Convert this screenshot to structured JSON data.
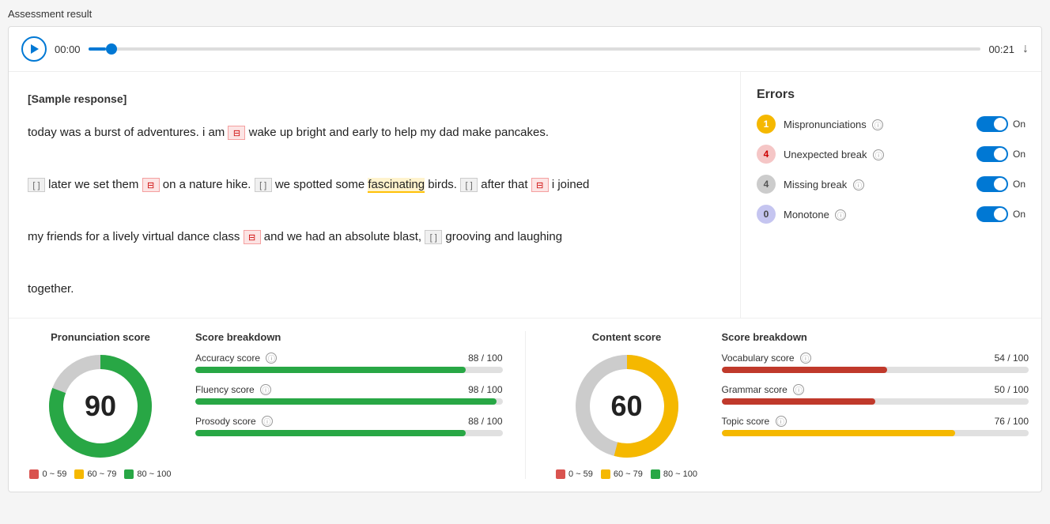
{
  "page": {
    "title": "Assessment result"
  },
  "audio": {
    "time_start": "00:00",
    "time_end": "00:21",
    "progress_pct": 2
  },
  "sample": {
    "label": "[Sample response]",
    "text_parts": [
      "today was a burst of adventures. i am",
      "wake up bright and early to help my dad make pancakes.",
      "later we set them",
      "on a nature hike.",
      "we spotted some",
      "fascinating",
      "birds.",
      "after that",
      "i joined my friends for a lively virtual dance class",
      "and we had an absolute blast,",
      "grooving and laughing together."
    ]
  },
  "errors": {
    "title": "Errors",
    "items": [
      {
        "badge": "1",
        "badge_color": "yellow",
        "label": "Mispronunciations",
        "toggle": "On"
      },
      {
        "badge": "4",
        "badge_color": "pink",
        "label": "Unexpected break",
        "toggle": "On"
      },
      {
        "badge": "4",
        "badge_color": "gray",
        "label": "Missing break",
        "toggle": "On"
      },
      {
        "badge": "0",
        "badge_color": "purple",
        "label": "Monotone",
        "toggle": "On"
      }
    ]
  },
  "pronunciation": {
    "title": "Pronunciation score",
    "score": "90",
    "breakdown_title": "Score breakdown",
    "items": [
      {
        "label": "Accuracy score",
        "value": "88 / 100",
        "pct": 88,
        "color": "green"
      },
      {
        "label": "Fluency score",
        "value": "98 / 100",
        "pct": 98,
        "color": "green"
      },
      {
        "label": "Prosody score",
        "value": "88 / 100",
        "pct": 88,
        "color": "green"
      }
    ],
    "legend": [
      {
        "label": "0 ~ 59",
        "color": "red"
      },
      {
        "label": "60 ~ 79",
        "color": "yellow"
      },
      {
        "label": "80 ~ 100",
        "color": "green"
      }
    ],
    "donut": {
      "value": 90,
      "color": "#28a745",
      "bg": "#ccc",
      "size": 130,
      "stroke": 18
    }
  },
  "content": {
    "title": "Content score",
    "score": "60",
    "breakdown_title": "Score breakdown",
    "items": [
      {
        "label": "Vocabulary score",
        "value": "54 / 100",
        "pct": 54,
        "color": "red"
      },
      {
        "label": "Grammar score",
        "value": "50 / 100",
        "pct": 50,
        "color": "red"
      },
      {
        "label": "Topic score",
        "value": "76 / 100",
        "pct": 76,
        "color": "yellow"
      }
    ],
    "legend": [
      {
        "label": "0 ~ 59",
        "color": "red"
      },
      {
        "label": "60 ~ 79",
        "color": "yellow"
      },
      {
        "label": "80 ~ 100",
        "color": "green"
      }
    ],
    "donut": {
      "value": 60,
      "color": "#f5b800",
      "bg": "#ccc",
      "size": 130,
      "stroke": 18
    }
  }
}
